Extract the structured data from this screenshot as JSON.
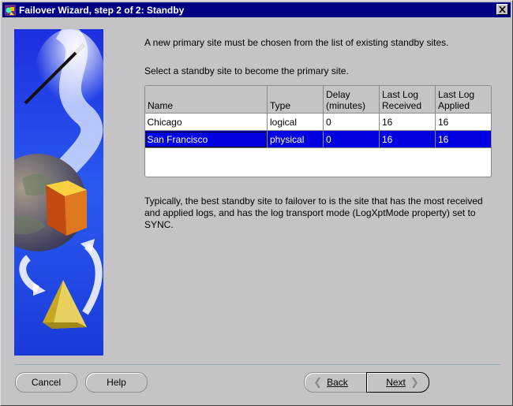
{
  "window": {
    "title": "Failover Wizard, step 2 of 2: Standby"
  },
  "intro_text": "A new primary site must be chosen from the list of existing standby sites.",
  "select_prompt": "Select a standby site to become the primary site.",
  "table": {
    "headers": [
      {
        "line1": "Name",
        "line2": ""
      },
      {
        "line1": "Type",
        "line2": ""
      },
      {
        "line1": "Delay",
        "line2": "(minutes)"
      },
      {
        "line1": "Last Log",
        "line2": "Received"
      },
      {
        "line1": "Last Log",
        "line2": "Applied"
      }
    ],
    "rows": [
      {
        "name": "Chicago",
        "type": "logical",
        "delay": "0",
        "received": "16",
        "applied": "16",
        "selected": false
      },
      {
        "name": "San Francisco",
        "type": "physical",
        "delay": "0",
        "received": "16",
        "applied": "16",
        "selected": true
      }
    ]
  },
  "hint_text": "Typically, the best standby site to failover to is the site that has the most received and applied logs, and has the log transport mode (LogXptMode property) set to SYNC.",
  "buttons": {
    "cancel": "Cancel",
    "help": "Help",
    "back": "Back",
    "next": "Next"
  },
  "icons": {
    "app": "oracle-wizard-icon",
    "close": "close-icon",
    "back": "chevron-left-icon",
    "next": "chevron-right-icon"
  },
  "colors": {
    "titlebar": "#000084",
    "selection": "#0000e0",
    "art_background": "#1a3fe0"
  }
}
